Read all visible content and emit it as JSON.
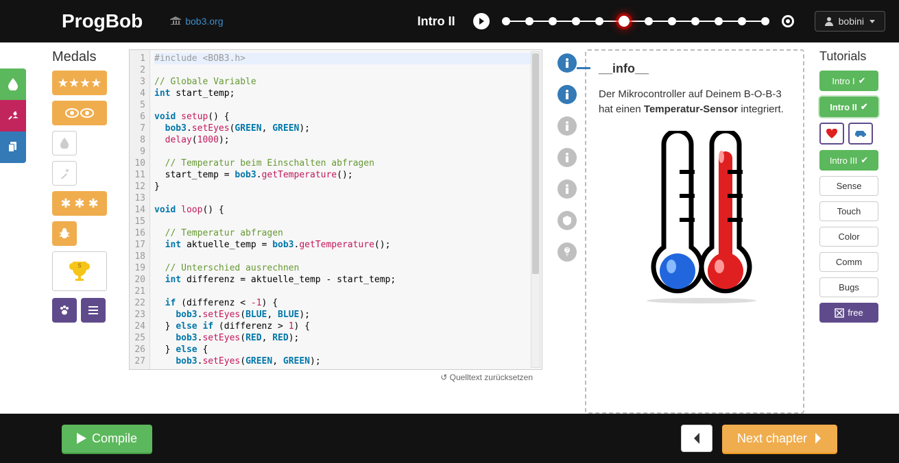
{
  "header": {
    "brand": "ProgBob",
    "site_link": "bob3.org",
    "chapter_label": "Intro II",
    "step_count": 12,
    "current_step": 6,
    "user_name": "bobini"
  },
  "medals": {
    "title": "Medals",
    "trophy_count": "5"
  },
  "editor": {
    "reset_label": "↺ Quelltext zurücksetzen",
    "lines": [
      {
        "n": 1,
        "tokens": [
          [
            "pp",
            "#include <BOB3.h>"
          ]
        ]
      },
      {
        "n": 2,
        "tokens": []
      },
      {
        "n": 3,
        "tokens": [
          [
            "cm",
            "// Globale Variable"
          ]
        ]
      },
      {
        "n": 4,
        "tokens": [
          [
            "ty",
            "int"
          ],
          [
            "",
            " start_temp;"
          ]
        ]
      },
      {
        "n": 5,
        "tokens": []
      },
      {
        "n": 6,
        "tokens": [
          [
            "ty",
            "void"
          ],
          [
            "",
            " "
          ],
          [
            "fn",
            "setup"
          ],
          [
            "",
            "() {"
          ]
        ]
      },
      {
        "n": 7,
        "tokens": [
          [
            "",
            "  "
          ],
          [
            "obj",
            "bob3"
          ],
          [
            "",
            "."
          ],
          [
            "fn",
            "setEyes"
          ],
          [
            "",
            "("
          ],
          [
            "const",
            "GREEN"
          ],
          [
            "",
            ", "
          ],
          [
            "const",
            "GREEN"
          ],
          [
            "",
            ");"
          ]
        ]
      },
      {
        "n": 8,
        "tokens": [
          [
            "",
            "  "
          ],
          [
            "fn",
            "delay"
          ],
          [
            "",
            "("
          ],
          [
            "num",
            "1000"
          ],
          [
            "",
            ");"
          ]
        ]
      },
      {
        "n": 9,
        "tokens": []
      },
      {
        "n": 10,
        "tokens": [
          [
            "",
            "  "
          ],
          [
            "cm",
            "// Temperatur beim Einschalten abfragen"
          ]
        ]
      },
      {
        "n": 11,
        "tokens": [
          [
            "",
            "  start_temp = "
          ],
          [
            "obj",
            "bob3"
          ],
          [
            "",
            "."
          ],
          [
            "fn",
            "getTemperature"
          ],
          [
            "",
            "();"
          ]
        ]
      },
      {
        "n": 12,
        "tokens": [
          [
            "",
            "}"
          ]
        ]
      },
      {
        "n": 13,
        "tokens": []
      },
      {
        "n": 14,
        "tokens": [
          [
            "ty",
            "void"
          ],
          [
            "",
            " "
          ],
          [
            "fn",
            "loop"
          ],
          [
            "",
            "() {"
          ]
        ]
      },
      {
        "n": 15,
        "tokens": []
      },
      {
        "n": 16,
        "tokens": [
          [
            "",
            "  "
          ],
          [
            "cm",
            "// Temperatur abfragen"
          ]
        ]
      },
      {
        "n": 17,
        "tokens": [
          [
            "",
            "  "
          ],
          [
            "ty",
            "int"
          ],
          [
            "",
            " aktuelle_temp = "
          ],
          [
            "obj",
            "bob3"
          ],
          [
            "",
            "."
          ],
          [
            "fn",
            "getTemperature"
          ],
          [
            "",
            "();"
          ]
        ]
      },
      {
        "n": 18,
        "tokens": []
      },
      {
        "n": 19,
        "tokens": [
          [
            "",
            "  "
          ],
          [
            "cm",
            "// Unterschied ausrechnen"
          ]
        ]
      },
      {
        "n": 20,
        "tokens": [
          [
            "",
            "  "
          ],
          [
            "ty",
            "int"
          ],
          [
            "",
            " differenz = aktuelle_temp - start_temp;"
          ]
        ]
      },
      {
        "n": 21,
        "tokens": []
      },
      {
        "n": 22,
        "tokens": [
          [
            "",
            "  "
          ],
          [
            "kw",
            "if"
          ],
          [
            "",
            " (differenz < "
          ],
          [
            "num",
            "-1"
          ],
          [
            "",
            ") {"
          ]
        ]
      },
      {
        "n": 23,
        "tokens": [
          [
            "",
            "    "
          ],
          [
            "obj",
            "bob3"
          ],
          [
            "",
            "."
          ],
          [
            "fn",
            "setEyes"
          ],
          [
            "",
            "("
          ],
          [
            "const",
            "BLUE"
          ],
          [
            "",
            ", "
          ],
          [
            "const",
            "BLUE"
          ],
          [
            "",
            ");"
          ]
        ]
      },
      {
        "n": 24,
        "tokens": [
          [
            "",
            "  } "
          ],
          [
            "kw",
            "else"
          ],
          [
            "",
            " "
          ],
          [
            "kw",
            "if"
          ],
          [
            "",
            " (differenz > "
          ],
          [
            "num",
            "1"
          ],
          [
            "",
            ") {"
          ]
        ]
      },
      {
        "n": 25,
        "tokens": [
          [
            "",
            "    "
          ],
          [
            "obj",
            "bob3"
          ],
          [
            "",
            "."
          ],
          [
            "fn",
            "setEyes"
          ],
          [
            "",
            "("
          ],
          [
            "const",
            "RED"
          ],
          [
            "",
            ", "
          ],
          [
            "const",
            "RED"
          ],
          [
            "",
            ");"
          ]
        ]
      },
      {
        "n": 26,
        "tokens": [
          [
            "",
            "  } "
          ],
          [
            "kw",
            "else"
          ],
          [
            "",
            " {"
          ]
        ]
      },
      {
        "n": 27,
        "tokens": [
          [
            "",
            "    "
          ],
          [
            "obj",
            "bob3"
          ],
          [
            "",
            "."
          ],
          [
            "fn",
            "setEyes"
          ],
          [
            "",
            "("
          ],
          [
            "const",
            "GREEN"
          ],
          [
            "",
            ", "
          ],
          [
            "const",
            "GREEN"
          ],
          [
            "",
            ");"
          ]
        ]
      }
    ]
  },
  "info": {
    "title": "__info__",
    "text_pre": "Der Mikrocontroller auf Deinem B-O-B-3 hat einen ",
    "text_bold": "Temperatur-Sensor",
    "text_post": " integriert."
  },
  "tutorials": {
    "title": "Tutorials",
    "items": [
      {
        "label": "Intro I",
        "style": "green",
        "check": true
      },
      {
        "label": "Intro II",
        "style": "green current",
        "check": true
      },
      {
        "label": "Intro III",
        "style": "green",
        "check": true
      },
      {
        "label": "Sense",
        "style": "white"
      },
      {
        "label": "Touch",
        "style": "white"
      },
      {
        "label": "Color",
        "style": "white"
      },
      {
        "label": "Comm",
        "style": "white"
      },
      {
        "label": "Bugs",
        "style": "white"
      }
    ],
    "free_label": "free"
  },
  "footer": {
    "compile_label": "Compile",
    "next_label": "Next chapter"
  }
}
